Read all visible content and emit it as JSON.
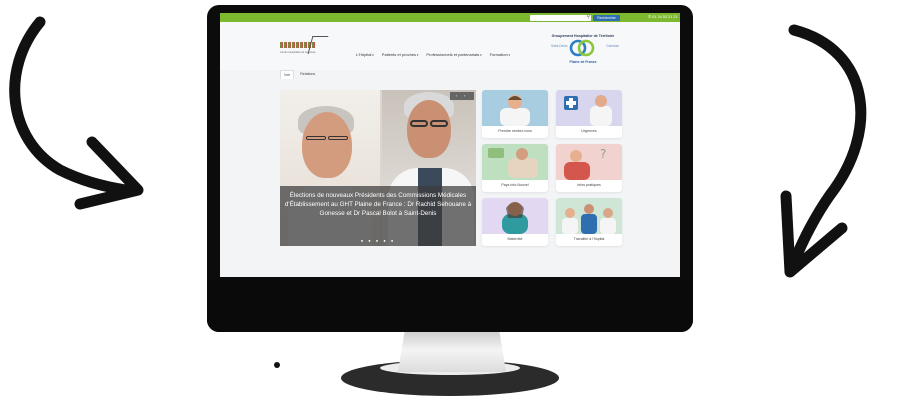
{
  "topbar": {
    "search_button": "Rechercher",
    "phone": "01 34 53 21 21",
    "search_icon": "search-icon",
    "phone_icon": "phone-icon"
  },
  "header": {
    "logo_caption": "Centre Hospitalier de Gonesse",
    "nav": [
      "L'Hôpital",
      "Patients et proches",
      "Professionnels et partenariats",
      "Formation"
    ],
    "ght": {
      "title": "Groupement Hospitalier de Territoire",
      "left": "Saint-Denis",
      "right": "Gonesse",
      "subtitle": "Plaine de France"
    }
  },
  "tabs": [
    "Voir",
    "Relations"
  ],
  "slider": {
    "caption": "Élections de nouveaux Présidents des Commissions Médicales d'Établissement au GHT Plaine de France : Dr Rachid Sehouane à Gonesse et Dr Pascal Bolot à Saint-Denis",
    "controls": "‹ ›",
    "dots": "● ● ● ● ●"
  },
  "cards": [
    {
      "label": "Prendre rendez-vous"
    },
    {
      "label": "Urgences"
    },
    {
      "label": "Pays info-Nouvel"
    },
    {
      "label": "Infos pratiques"
    },
    {
      "label": "Maternité"
    },
    {
      "label": "Travailler à l'hôpital"
    }
  ],
  "colors": {
    "topbar_green": "#7db92e",
    "search_blue": "#2f6fb0",
    "ght_blue": "#2b5f9e"
  }
}
